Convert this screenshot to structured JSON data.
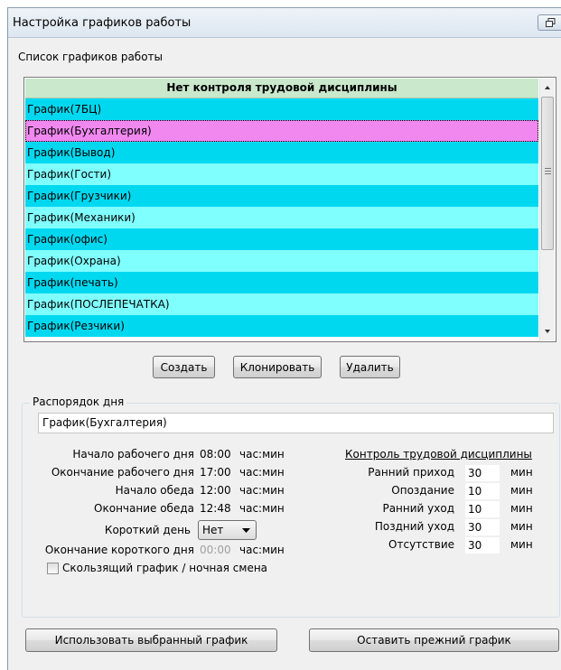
{
  "window": {
    "title": "Настройка графиков работы"
  },
  "list": {
    "caption": "Список графиков работы",
    "header": "Нет контроля трудовой дисциплины",
    "items": [
      "График(7БЦ)",
      "График(Бухгалтерия)",
      "График(Вывод)",
      "График(Гости)",
      "График(Грузчики)",
      "График(Механики)",
      "График(офис)",
      "График(Охрана)",
      "График(печать)",
      "График(ПОСЛЕПЕЧАТКА)",
      "График(Резчики)"
    ],
    "selected_index": 1,
    "row_colors": {
      "a": "#00d8f0",
      "b": "#80ffff",
      "selected": "#f088f0"
    }
  },
  "buttons": {
    "create": "Создать",
    "clone": "Клонировать",
    "delete": "Удалить",
    "use_selected": "Использовать выбранный график",
    "keep_previous": "Оставить прежний график"
  },
  "schedule": {
    "group_title": "Распорядок дня",
    "name": "График(Бухгалтерия)",
    "work_start_label": "Начало рабочего дня",
    "work_start": "08:00",
    "work_end_label": "Окончание рабочего дня",
    "work_end": "17:00",
    "lunch_start_label": "Начало обеда",
    "lunch_start": "12:00",
    "lunch_end_label": "Окончание обеда",
    "lunch_end": "12:48",
    "short_day_label": "Короткий день",
    "short_day_value": "Нет",
    "short_day_end_label": "Окончание короткого дня",
    "short_day_end": "00:00",
    "time_unit": "час:мин",
    "sliding_label": "Скользящий график / ночная смена",
    "sliding_checked": false
  },
  "discipline": {
    "title": "Контроль трудовой дисциплины",
    "unit": "мин",
    "early_arrival_label": "Ранний приход",
    "early_arrival": "30",
    "late_label": "Опоздание",
    "late": "10",
    "early_leave_label": "Ранний уход",
    "early_leave": "10",
    "late_leave_label": "Поздний уход",
    "late_leave": "30",
    "absence_label": "Отсутствие",
    "absence": "30"
  }
}
